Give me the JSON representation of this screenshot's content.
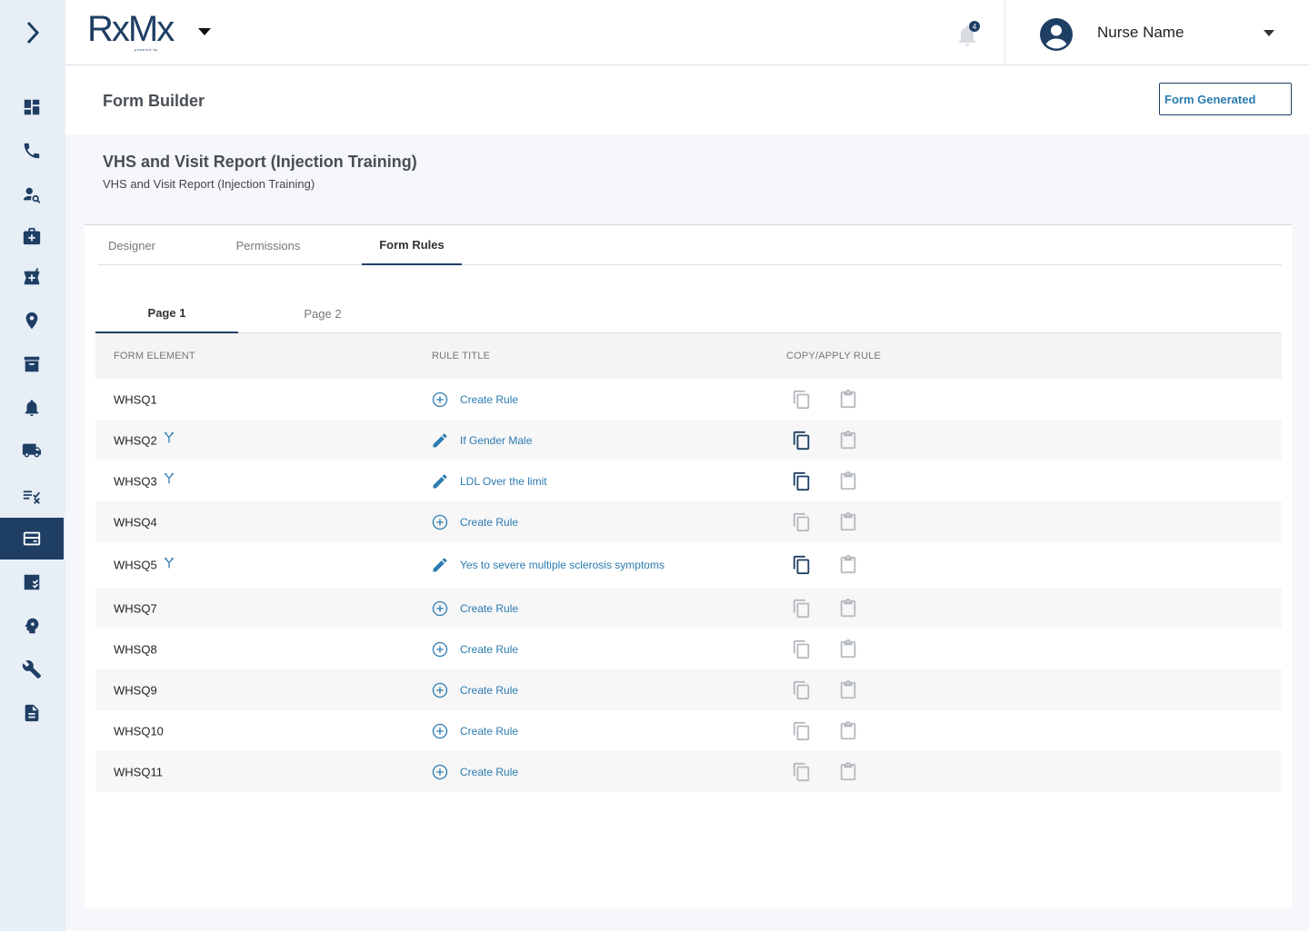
{
  "colors": {
    "navy": "#1e3e64",
    "link": "#2b7bb0",
    "muted_icon": "#b5b9be",
    "sidebar_bg": "#e8eef6"
  },
  "header": {
    "logo_text": "RxMx",
    "logo_subtext": "powered by",
    "notification_count": "4",
    "user_name": "Nurse Name"
  },
  "sidebar": {
    "items": [
      {
        "icon": "dashboard-icon"
      },
      {
        "icon": "phone-icon"
      },
      {
        "icon": "person-search-icon"
      },
      {
        "icon": "medical-bag-icon"
      },
      {
        "icon": "pharmacy-icon"
      },
      {
        "icon": "location-pin-icon"
      },
      {
        "icon": "archive-icon"
      },
      {
        "icon": "bell-icon"
      },
      {
        "icon": "truck-icon"
      },
      {
        "icon": "checklist-icon"
      },
      {
        "icon": "form-builder-icon",
        "active": true
      },
      {
        "icon": "task-list-icon"
      },
      {
        "icon": "head-gear-icon"
      },
      {
        "icon": "wrench-icon"
      },
      {
        "icon": "document-icon"
      }
    ]
  },
  "titlebar": {
    "title": "Form Builder",
    "form_generated_label": "Form Generated"
  },
  "form": {
    "title": "VHS and Visit Report (Injection Training)",
    "subtitle": "VHS and Visit Report (Injection Training)"
  },
  "tabs": [
    {
      "label": "Designer"
    },
    {
      "label": "Permissions"
    },
    {
      "label": "Form Rules",
      "active": true
    }
  ],
  "subtabs": [
    {
      "label": "Page 1",
      "active": true
    },
    {
      "label": "Page 2"
    }
  ],
  "table": {
    "headers": [
      "FORM ELEMENT",
      "RULE TITLE",
      "COPY/APPLY RULE"
    ],
    "rows": [
      {
        "element": "WHSQ1",
        "branch": false,
        "rule": "Create Rule",
        "has_rule": false
      },
      {
        "element": "WHSQ2",
        "branch": true,
        "rule": "If Gender Male",
        "has_rule": true
      },
      {
        "element": "WHSQ3",
        "branch": true,
        "rule": "LDL Over the limit",
        "has_rule": true
      },
      {
        "element": "WHSQ4",
        "branch": false,
        "rule": "Create Rule",
        "has_rule": false
      },
      {
        "element": "WHSQ5",
        "branch": true,
        "rule": "Yes to severe multiple sclerosis symptoms",
        "has_rule": true
      },
      {
        "element": "WHSQ7",
        "branch": false,
        "rule": "Create Rule",
        "has_rule": false
      },
      {
        "element": "WHSQ8",
        "branch": false,
        "rule": "Create Rule",
        "has_rule": false
      },
      {
        "element": "WHSQ9",
        "branch": false,
        "rule": "Create Rule",
        "has_rule": false
      },
      {
        "element": "WHSQ10",
        "branch": false,
        "rule": "Create Rule",
        "has_rule": false
      },
      {
        "element": "WHSQ11",
        "branch": false,
        "rule": "Create Rule",
        "has_rule": false
      }
    ]
  }
}
